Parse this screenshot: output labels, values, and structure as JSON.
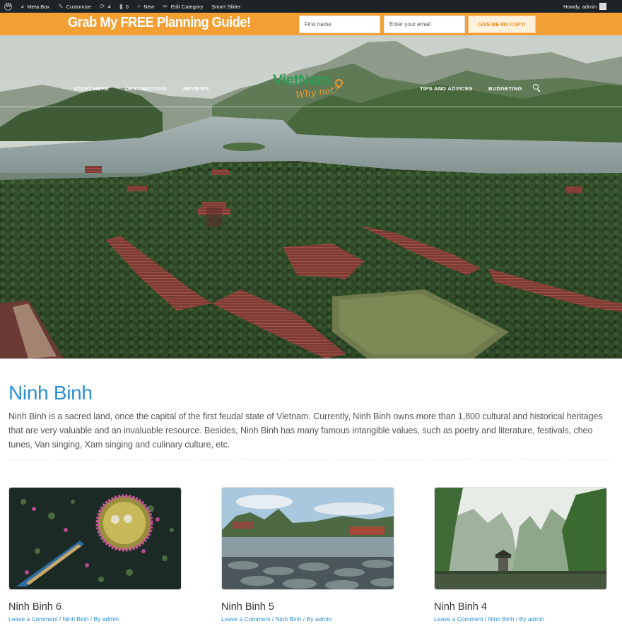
{
  "admin_bar": {
    "site": "Meta Box",
    "customize": "Customize",
    "updates": "4",
    "comments": "0",
    "new": "New",
    "edit_category": "Edit Category",
    "smart_slider": "Smart Slider",
    "howdy": "Howdy, admin"
  },
  "optin": {
    "title": "Grab My FREE Planning Guide!",
    "first_name_placeholder": "First name",
    "email_placeholder": "Enter your email",
    "button": "GIVE ME MY COPY!"
  },
  "nav": {
    "items": [
      "START HERE",
      "DESTINATIONS",
      "REVIEWS",
      "TIPS AND ADVICES",
      "BUDGETING"
    ],
    "logo_main": "VietNam",
    "logo_sub": "Why not?"
  },
  "category": {
    "title": "Ninh Binh",
    "description": "Ninh Binh is a sacred land, once the capital of the first feudal state of Vietnam. Currently, Ninh Binh owns more than 1,800 cultural and historical heritages that are very valuable and an invaluable resource. Besides, Ninh Binh has many famous intangible values, such as poetry and literature, festivals, cheo tunes, Van singing, Xam singing and culinary culture, etc."
  },
  "posts": [
    {
      "title": "Ninh Binh 6",
      "comment": "Leave a Comment",
      "category": "Ninh Binh",
      "by": "By",
      "author": "admin"
    },
    {
      "title": "Ninh Binh 5",
      "comment": "Leave a Comment",
      "category": "Ninh Binh",
      "by": "By",
      "author": "admin"
    },
    {
      "title": "Ninh Binh 4",
      "comment": "Leave a Comment",
      "category": "Ninh Binh",
      "by": "By",
      "author": "admin"
    }
  ],
  "colors": {
    "admin_bar": "#1d2327",
    "optin_bar": "#f29f33",
    "link_blue": "#2b8fd6",
    "logo_green": "#2f9d53",
    "logo_orange": "#f39b2e"
  }
}
